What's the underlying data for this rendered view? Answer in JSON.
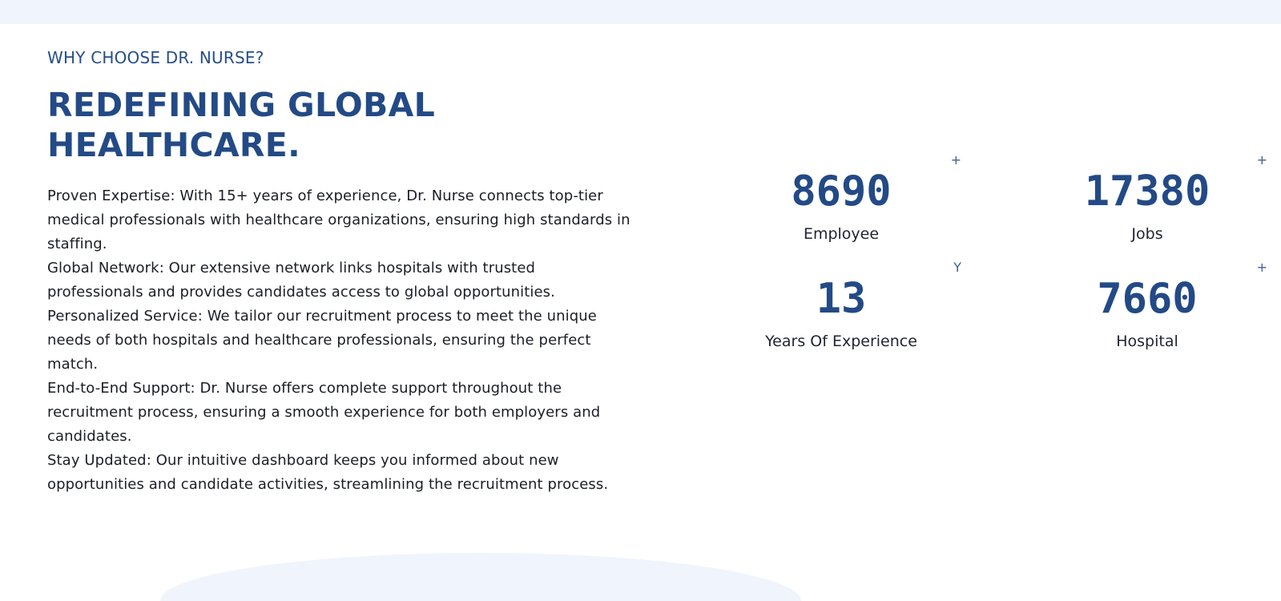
{
  "section": {
    "eyebrow": "WHY CHOOSE DR. NURSE?",
    "headline_line1": "REDEFINING GLOBAL",
    "headline_line2": "HEALTHCARE."
  },
  "features": [
    "Proven Expertise: With 15+ years of experience, Dr. Nurse connects top-tier medical professionals with healthcare organizations, ensuring high standards in staffing.",
    "Global Network: Our extensive network links hospitals with trusted professionals and provides candidates access to global opportunities.",
    "Personalized Service: We tailor our recruitment process to meet the unique needs of both hospitals and healthcare professionals, ensuring the perfect match.",
    "End-to-End Support: Dr. Nurse offers complete support throughout the recruitment process, ensuring a smooth experience for both employers and candidates.",
    "Stay Updated: Our intuitive dashboard keeps you informed about new opportunities and candidate activities, streamlining the recruitment process."
  ],
  "stats": [
    {
      "value": "8690",
      "suffix": "+",
      "label": "Employee"
    },
    {
      "value": "17380",
      "suffix": "+",
      "label": "Jobs"
    },
    {
      "value": "13",
      "suffix": "Y",
      "label": "Years Of Experience"
    },
    {
      "value": "7660",
      "suffix": "+",
      "label": "Hospital"
    }
  ],
  "colors": {
    "brand": "#234a86",
    "band": "#f0f4fd"
  }
}
